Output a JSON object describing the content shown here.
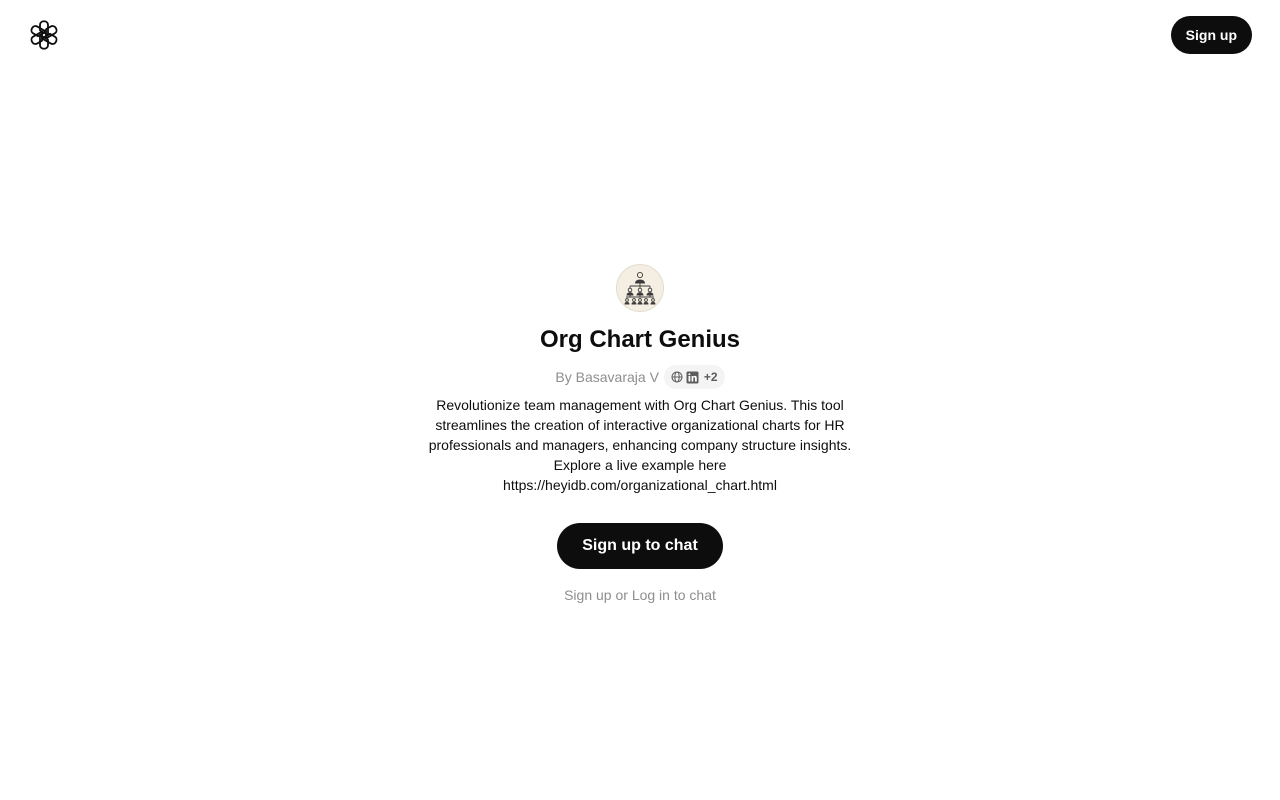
{
  "header": {
    "logo_icon": "openai-logo-icon",
    "signup_label": "Sign up"
  },
  "gpt": {
    "avatar_icon": "org-chart-icon",
    "title": "Org Chart Genius",
    "author": "By Basavaraja V",
    "social_icons": [
      "globe-icon",
      "linkedin-icon"
    ],
    "social_more": "+2",
    "description_lines": [
      "Revolutionize team management with Org Chart Genius. This tool",
      "streamlines the creation of interactive organizational charts for HR",
      "professionals and managers, enhancing company structure insights.",
      "Explore a live example here",
      "https://heyidb.com/organizational_chart.html"
    ]
  },
  "actions": {
    "chat_button_label": "Sign up to chat",
    "signup_link": "Sign up",
    "or_text": " or ",
    "login_link": "Log in",
    "suffix_text": " to chat"
  },
  "colors": {
    "primary_button": "#0d0d0d",
    "muted_text": "#8e8e8e",
    "pill_background": "#f4f4f4"
  }
}
